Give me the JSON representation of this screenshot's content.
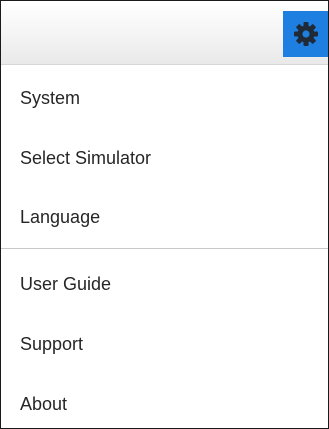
{
  "header": {
    "settings_icon": "gear-icon",
    "accent_color": "#1e7fe0"
  },
  "menu": {
    "items": [
      {
        "label": "System"
      },
      {
        "label": "Select Simulator"
      },
      {
        "label": "Language"
      },
      {
        "label": "User Guide"
      },
      {
        "label": "Support"
      },
      {
        "label": "About"
      }
    ]
  }
}
